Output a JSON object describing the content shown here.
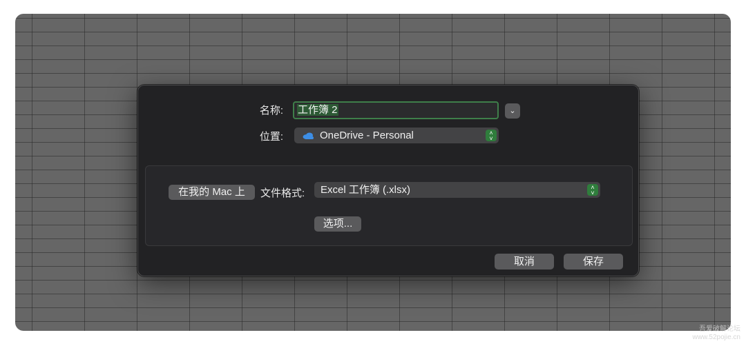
{
  "dialog": {
    "name_label": "名称:",
    "name_value": "工作簿 2",
    "location_label": "位置:",
    "location_value": "OneDrive - Personal",
    "location_icon": "onedrive-cloud-icon",
    "on_my_mac_button": "在我的 Mac 上",
    "file_format_label": "文件格式:",
    "file_format_value": "Excel 工作簿 (.xlsx)",
    "options_button": "选项...",
    "cancel_button": "取消",
    "save_button": "保存"
  },
  "watermark": {
    "line1": "吾爱破解论坛",
    "line2": "www.52pojie.cn"
  },
  "colors": {
    "dialog_bg": "#222224",
    "accent_green": "#2f7d3c",
    "focus_ring": "#3f7f4a",
    "onedrive_blue": "#3d8ee5"
  }
}
